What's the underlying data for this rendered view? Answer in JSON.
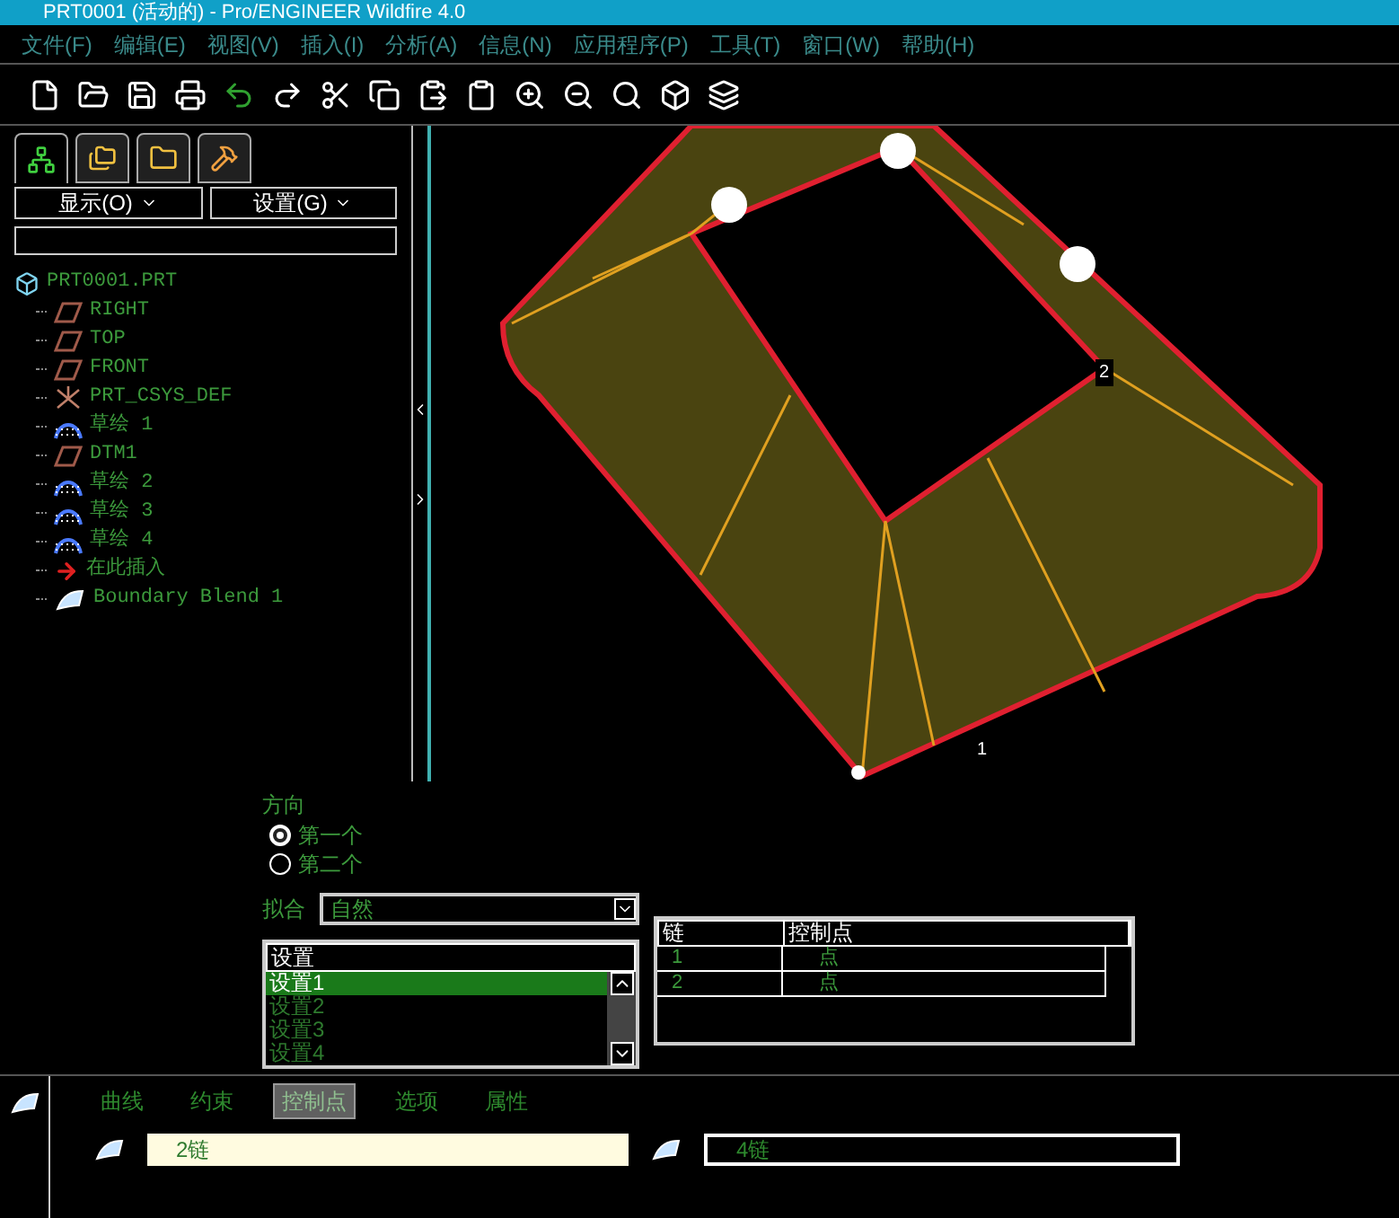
{
  "window": {
    "title": "PRT0001 (活动的) - Pro/ENGINEER Wildfire 4.0"
  },
  "menu": [
    "文件(F)",
    "编辑(E)",
    "视图(V)",
    "插入(I)",
    "分析(A)",
    "信息(N)",
    "应用程序(P)",
    "工具(T)",
    "窗口(W)",
    "帮助(H)"
  ],
  "navigator_tabs": [
    {
      "kind": "tree",
      "selected": true
    },
    {
      "kind": "folders",
      "selected": false
    },
    {
      "kind": "favorites",
      "selected": false
    },
    {
      "kind": "tools",
      "selected": false
    }
  ],
  "tree_buttons": [
    "显示(O)",
    "设置(G)"
  ],
  "tree": {
    "label": "PRT0001.PRT",
    "kind": "part",
    "children": [
      {
        "label": "RIGHT",
        "kind": "plane"
      },
      {
        "label": "TOP",
        "kind": "plane"
      },
      {
        "label": "FRONT",
        "kind": "plane"
      },
      {
        "label": "PRT_CSYS_DEF",
        "kind": "csys"
      },
      {
        "label": "草绘 1",
        "kind": "sketch"
      },
      {
        "label": "DTM1",
        "kind": "plane"
      },
      {
        "label": "草绘 2",
        "kind": "sketch"
      },
      {
        "label": "草绘 3",
        "kind": "sketch"
      },
      {
        "label": "草绘 4",
        "kind": "sketch"
      },
      {
        "label": "在此插入",
        "kind": "insert"
      },
      {
        "label": "Boundary Blend 1",
        "kind": "blend"
      }
    ]
  },
  "viewport_labels": [
    "2",
    "1"
  ],
  "direction": {
    "label": "方向",
    "options": [
      {
        "label": "第一个",
        "selected": true
      },
      {
        "label": "第二个",
        "selected": false
      }
    ]
  },
  "fit": {
    "label": "拟合",
    "value": "自然"
  },
  "settings_list": {
    "header": "设置",
    "items": [
      {
        "label": "设置1",
        "selected": true
      },
      {
        "label": "设置2",
        "selected": false
      },
      {
        "label": "设置3",
        "selected": false
      },
      {
        "label": "设置4",
        "selected": false
      }
    ]
  },
  "chain_table": {
    "columns": [
      "链",
      "控制点"
    ],
    "rows": [
      [
        "1",
        "点"
      ],
      [
        "2",
        "点"
      ]
    ]
  },
  "dashboard": {
    "tabs": [
      {
        "label": "曲线",
        "selected": false
      },
      {
        "label": "约束",
        "selected": false
      },
      {
        "label": "控制点",
        "selected": true
      },
      {
        "label": "选项",
        "selected": false
      },
      {
        "label": "属性",
        "selected": false
      }
    ],
    "fields": [
      {
        "value": "2链",
        "active": true
      },
      {
        "value": "4链",
        "active": false
      }
    ]
  }
}
